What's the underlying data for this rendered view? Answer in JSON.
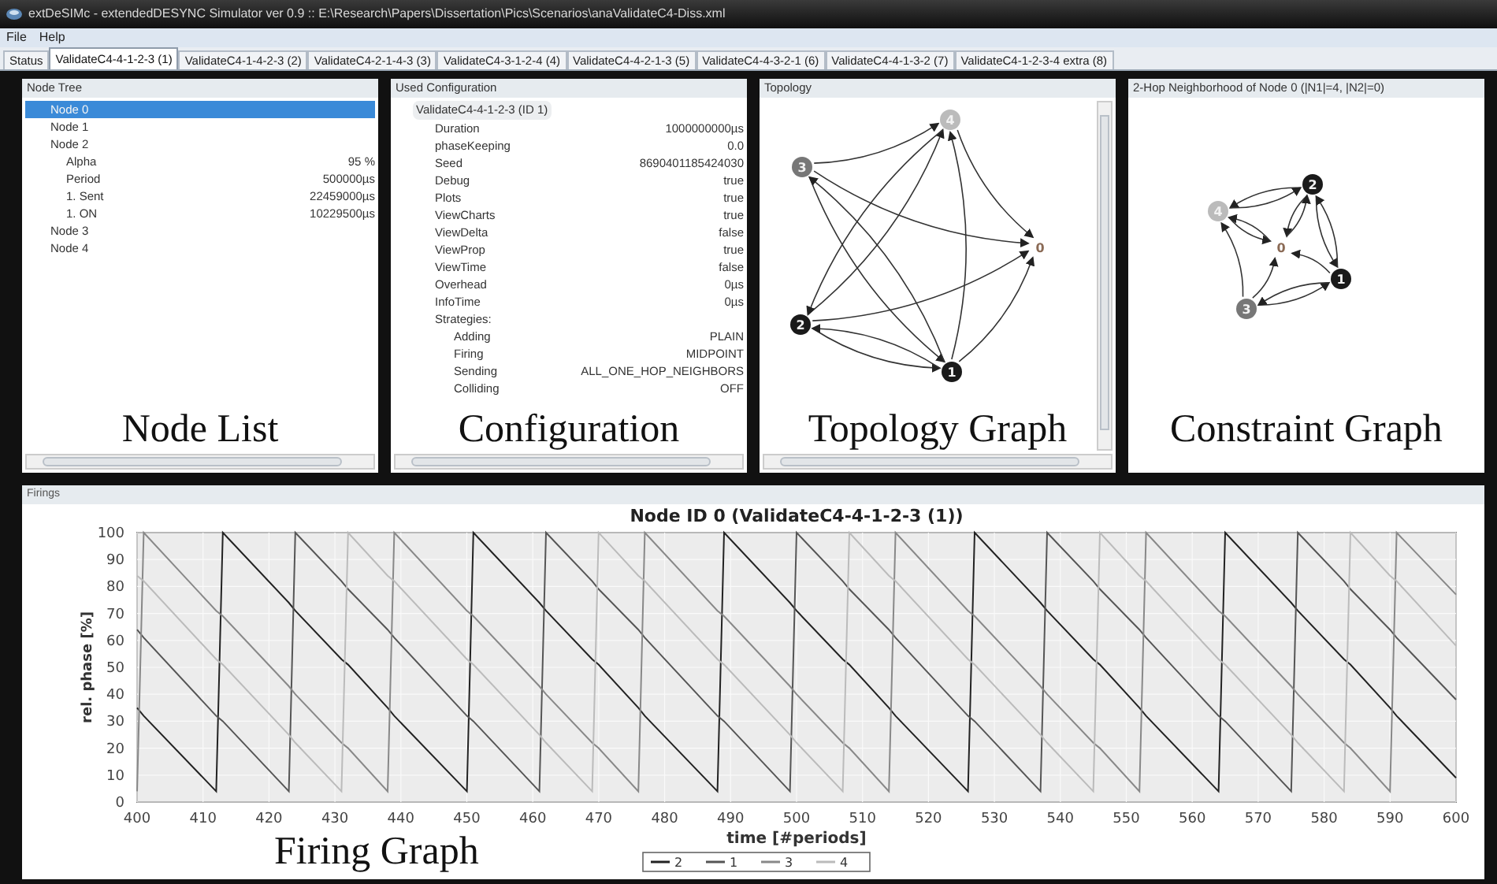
{
  "window": {
    "title": "extDeSIMc - extendedDESYNC Simulator ver 0.9 :: E:\\Research\\Papers\\Dissertation\\Pics\\Scenarios\\anaValidateC4-Diss.xml"
  },
  "menu": [
    "File",
    "Help"
  ],
  "tabs": [
    {
      "label": "Status",
      "selected": false
    },
    {
      "label": "ValidateC4-4-1-2-3 (1)",
      "selected": true
    },
    {
      "label": "ValidateC4-1-4-2-3 (2)",
      "selected": false
    },
    {
      "label": "ValidateC4-2-1-4-3 (3)",
      "selected": false
    },
    {
      "label": "ValidateC4-3-1-2-4 (4)",
      "selected": false
    },
    {
      "label": "ValidateC4-4-2-1-3 (5)",
      "selected": false
    },
    {
      "label": "ValidateC4-4-3-2-1 (6)",
      "selected": false
    },
    {
      "label": "ValidateC4-4-1-3-2 (7)",
      "selected": false
    },
    {
      "label": "ValidateC4-1-2-3-4 extra (8)",
      "selected": false
    }
  ],
  "node_tree": {
    "title": "Node Tree",
    "caption": "Node List",
    "items": [
      {
        "label": "Node 0",
        "selected": true
      },
      {
        "label": "Node 1",
        "selected": false
      },
      {
        "label": "Node 2",
        "selected": false,
        "children": [
          {
            "label": "Alpha",
            "value": "95 %"
          },
          {
            "label": "Period",
            "value": "500000µs"
          },
          {
            "label": "1. Sent",
            "value": "22459000µs"
          },
          {
            "label": "1. ON",
            "value": "10229500µs"
          }
        ]
      },
      {
        "label": "Node 3",
        "selected": false
      },
      {
        "label": "Node 4",
        "selected": false
      }
    ]
  },
  "configuration": {
    "title": "Used Configuration",
    "caption": "Configuration",
    "root": "ValidateC4-4-1-2-3 (ID 1)",
    "rows": [
      {
        "label": "Duration",
        "value": "1000000000µs"
      },
      {
        "label": "phaseKeeping",
        "value": "0.0"
      },
      {
        "label": "Seed",
        "value": "8690401185424030"
      },
      {
        "label": "Debug",
        "value": "true"
      },
      {
        "label": "Plots",
        "value": "true"
      },
      {
        "label": "ViewCharts",
        "value": "true"
      },
      {
        "label": "ViewDelta",
        "value": "false"
      },
      {
        "label": "ViewProp",
        "value": "true"
      },
      {
        "label": "ViewTime",
        "value": "false"
      },
      {
        "label": "Overhead",
        "value": "0µs"
      },
      {
        "label": "InfoTime",
        "value": "0µs"
      },
      {
        "label": "Strategies:",
        "children": [
          {
            "label": "Adding",
            "value": "PLAIN"
          },
          {
            "label": "Firing",
            "value": "MIDPOINT"
          },
          {
            "label": "Sending",
            "value": "ALL_ONE_HOP_NEIGHBORS"
          },
          {
            "label": "Colliding",
            "value": "OFF"
          }
        ]
      }
    ]
  },
  "topology": {
    "title": "Topology",
    "caption": "Topology Graph",
    "nodes": [
      {
        "label": "0"
      },
      {
        "label": "1",
        "color": "#1a1a1a"
      },
      {
        "label": "2",
        "color": "#1a1a1a"
      },
      {
        "label": "3",
        "color": "#777777"
      },
      {
        "label": "4",
        "color": "#bbbbbb"
      }
    ]
  },
  "neighborhood": {
    "title": "2-Hop Neighborhood of Node 0 (|N1|=4, |N2|=0)",
    "caption": "Constraint Graph",
    "nodes": [
      {
        "label": "0"
      },
      {
        "label": "1",
        "color": "#1a1a1a"
      },
      {
        "label": "2",
        "color": "#1a1a1a"
      },
      {
        "label": "3",
        "color": "#777777"
      },
      {
        "label": "4",
        "color": "#bbbbbb"
      }
    ]
  },
  "firings": {
    "title": "Firings",
    "caption": "Firing Graph",
    "chart_data": {
      "type": "line",
      "title": "Node ID 0 (ValidateC4-4-1-2-3 (1))",
      "xlabel": "time [#periods]",
      "ylabel": "rel. phase [%]",
      "x": [
        400,
        401,
        412,
        413,
        423,
        424,
        431,
        432,
        438,
        439,
        450,
        451,
        461,
        462,
        469,
        470,
        476,
        477,
        488,
        489,
        499,
        500,
        507,
        508,
        514,
        515,
        526,
        527,
        537,
        538,
        545,
        546,
        552,
        553,
        564,
        565,
        575,
        576,
        583,
        584,
        590,
        591,
        600
      ],
      "series": [
        {
          "name": "2",
          "color": "#222222",
          "values": [
            35,
            32,
            4,
            100,
            74,
            71,
            53,
            51,
            35,
            32,
            4,
            100,
            74,
            71,
            53,
            51,
            35,
            32,
            4,
            100,
            74,
            71,
            53,
            51,
            35,
            32,
            4,
            100,
            74,
            71,
            53,
            51,
            35,
            32,
            4,
            100,
            74,
            71,
            53,
            51,
            35,
            32,
            9
          ]
        },
        {
          "name": "1",
          "color": "#555555",
          "values": [
            64,
            61,
            32,
            30,
            4,
            100,
            82,
            79,
            64,
            61,
            32,
            30,
            4,
            100,
            82,
            79,
            64,
            61,
            32,
            30,
            4,
            100,
            82,
            79,
            64,
            61,
            32,
            30,
            4,
            100,
            82,
            79,
            64,
            61,
            32,
            30,
            4,
            100,
            82,
            79,
            64,
            61,
            38
          ]
        },
        {
          "name": "3",
          "color": "#888888",
          "values": [
            4,
            100,
            71,
            69,
            43,
            40,
            22,
            20,
            4,
            100,
            71,
            69,
            43,
            40,
            22,
            20,
            4,
            100,
            71,
            69,
            43,
            40,
            22,
            20,
            4,
            100,
            71,
            69,
            43,
            40,
            22,
            20,
            4,
            100,
            71,
            69,
            43,
            40,
            22,
            20,
            4,
            100,
            77
          ]
        },
        {
          "name": "4",
          "color": "#bbbbbb",
          "values": [
            84,
            82,
            53,
            51,
            25,
            22,
            4,
            100,
            84,
            82,
            53,
            51,
            25,
            22,
            4,
            100,
            84,
            82,
            53,
            51,
            25,
            22,
            4,
            100,
            84,
            82,
            53,
            51,
            25,
            22,
            4,
            100,
            84,
            82,
            53,
            51,
            25,
            22,
            4,
            100,
            84,
            82,
            58
          ]
        }
      ],
      "xlim": [
        400,
        600
      ],
      "ylim": [
        0,
        100
      ],
      "xticks": [
        400,
        410,
        420,
        430,
        440,
        450,
        460,
        470,
        480,
        490,
        500,
        510,
        520,
        530,
        540,
        550,
        560,
        570,
        580,
        590,
        600
      ],
      "yticks": [
        0,
        10,
        20,
        30,
        40,
        50,
        60,
        70,
        80,
        90,
        100
      ],
      "grid": true,
      "legend": true
    }
  }
}
